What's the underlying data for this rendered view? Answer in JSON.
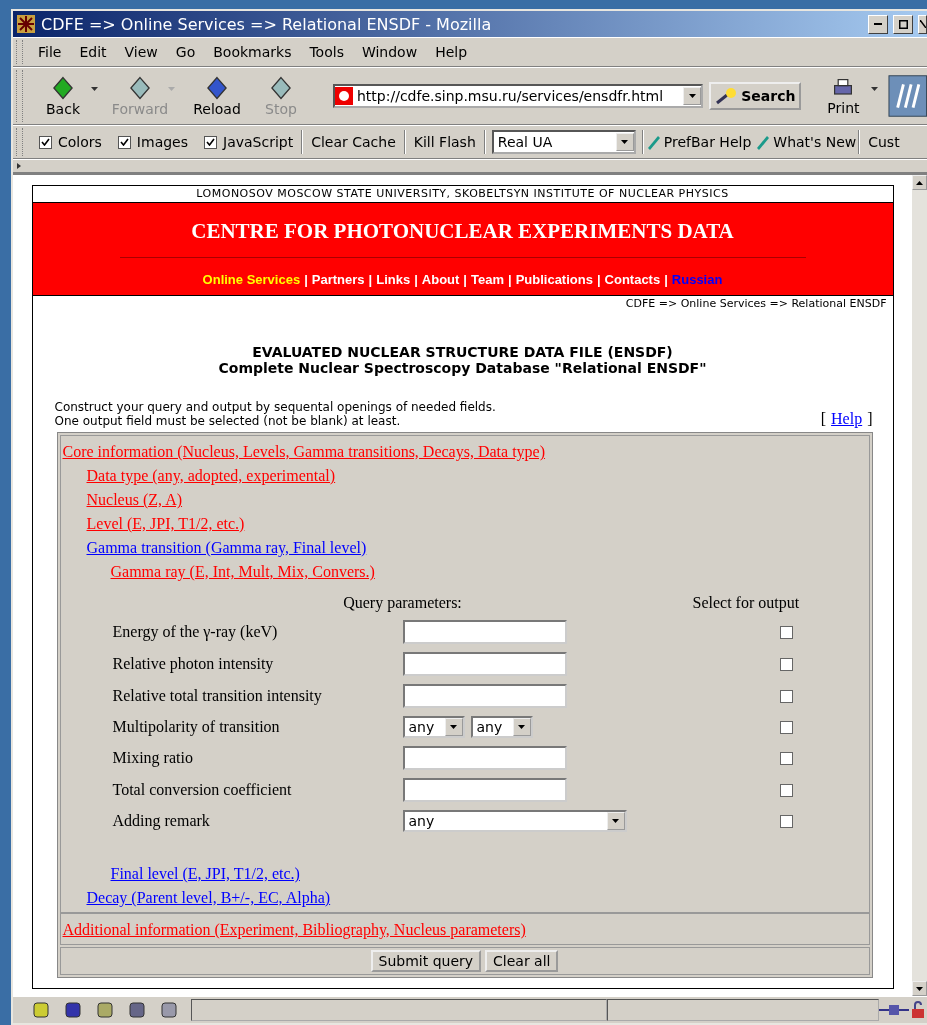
{
  "window": {
    "title": "CDFE => Online Services => Relational ENSDF - Mozilla"
  },
  "menu": [
    "File",
    "Edit",
    "View",
    "Go",
    "Bookmarks",
    "Tools",
    "Window",
    "Help"
  ],
  "nav_buttons": [
    {
      "label": "Back",
      "disabled": false,
      "dropdown": true
    },
    {
      "label": "Forward",
      "disabled": true,
      "dropdown": true
    },
    {
      "label": "Reload",
      "disabled": false,
      "dropdown": false
    },
    {
      "label": "Stop",
      "disabled": true,
      "dropdown": false
    }
  ],
  "address": {
    "value": "http://cdfe.sinp.msu.ru/services/ensdfr.html"
  },
  "search_button": "Search",
  "print_button": "Print",
  "prefbar": {
    "checks": [
      {
        "label": "Colors",
        "checked": true
      },
      {
        "label": "Images",
        "checked": true
      },
      {
        "label": "JavaScript",
        "checked": true
      }
    ],
    "buttons": [
      "Clear Cache",
      "Kill Flash"
    ],
    "ua": "Real UA",
    "links": [
      "PrefBar Help",
      "What's New"
    ],
    "cut": "Cust"
  },
  "page": {
    "top_line": "LOMONOSOV MOSCOW STATE UNIVERSITY, SKOBELTSYN INSTITUTE OF NUCLEAR PHYSICS",
    "banner": "CENTRE FOR PHOTONUCLEAR EXPERIMENTS DATA",
    "nav": [
      {
        "kind": "link",
        "label": "Online Services",
        "color": "#ffff00"
      },
      {
        "kind": "separator",
        "label": "|"
      },
      {
        "kind": "link",
        "label": "Partners",
        "color": "#ffffff"
      },
      {
        "kind": "separator",
        "label": "|"
      },
      {
        "kind": "link",
        "label": "Links",
        "color": "#ffffff"
      },
      {
        "kind": "separator",
        "label": "|"
      },
      {
        "kind": "link",
        "label": "About",
        "color": "#ffffff"
      },
      {
        "kind": "separator",
        "label": "|"
      },
      {
        "kind": "link",
        "label": "Team",
        "color": "#ffffff"
      },
      {
        "kind": "separator",
        "label": "|"
      },
      {
        "kind": "link",
        "label": "Publications",
        "color": "#ffffff"
      },
      {
        "kind": "separator",
        "label": "|"
      },
      {
        "kind": "link",
        "label": "Contacts",
        "color": "#ffffff"
      },
      {
        "kind": "separator",
        "label": "|"
      },
      {
        "kind": "link",
        "label": "Russian",
        "color": "#0000ff"
      }
    ],
    "breadcrumb": "CDFE => Online Services => Relational ENSDF",
    "heading": [
      "EVALUATED NUCLEAR STRUCTURE DATA FILE (ENSDF)",
      "Complete Nuclear Spectroscopy Database \"Relational ENSDF\""
    ],
    "intro": [
      "Construct your query and output by sequental openings of needed fields.",
      "One output field must be selected (not be blank) at least."
    ],
    "help": {
      "open": "[",
      "link": "Help",
      "close": "]"
    },
    "sections": [
      {
        "label": "Core information (Nucleus, Levels, Gamma transitions, Decays, Data type)",
        "color": "#ff0000",
        "children": [
          {
            "label": "Data type (any, adopted, experimental)",
            "color": "#ff0000"
          },
          {
            "label": "Nucleus (Z, A)",
            "color": "#ff0000"
          },
          {
            "label": "Level (E, JPI, T1/2, etc.)",
            "color": "#ff0000"
          },
          {
            "label": "Gamma transition (Gamma ray, Final level)",
            "color": "#0000ff",
            "children": [
              {
                "label": "Gamma ray (E, Int, Mult, Mix, Convers.)",
                "color": "#ff0000",
                "form": true
              },
              {
                "label": "Final level (E, JPI, T1/2, etc.)",
                "color": "#0000ff"
              }
            ]
          },
          {
            "label": "Decay (Parent level, B+/-, EC, Alpha)",
            "color": "#0000ff"
          }
        ]
      },
      {
        "label": "Additional information (Experiment, Bibliography, Nucleus parameters)",
        "color": "#ff0000"
      }
    ],
    "form": {
      "query_header": "Query parameters:",
      "output_header": "Select for output",
      "rows": [
        {
          "label": "Energy of the γ-ray (keV)",
          "kind": "text",
          "output": false
        },
        {
          "label": "Relative photon intensity",
          "kind": "text",
          "output": false
        },
        {
          "label": "Relative total transition intensity",
          "kind": "text",
          "output": false
        },
        {
          "label": "Multipolarity of transition",
          "kind": "pair",
          "values": [
            "any",
            "any"
          ],
          "output": false
        },
        {
          "label": "Mixing ratio",
          "kind": "text",
          "output": false
        },
        {
          "label": "Total conversion coefficient",
          "kind": "text",
          "output": false
        },
        {
          "label": "Adding remark",
          "kind": "wide",
          "values": [
            "any"
          ],
          "output": false
        }
      ]
    },
    "actions": [
      "Submit query",
      "Clear all"
    ]
  }
}
